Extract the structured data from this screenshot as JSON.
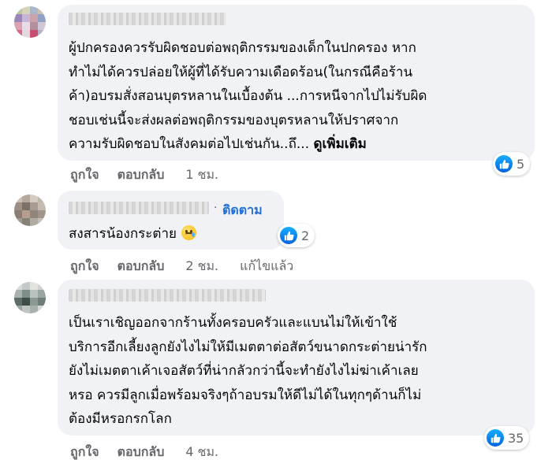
{
  "comments": [
    {
      "text": "ผู้ปกครองควรรับผิดชอบต่อพฤติกรรมของเด็กในปกครอง หาก\nทำไม่ได้ควรปล่อยให้ผู้ที่ได้รับความเดือดร้อน(ในกรณีคือร้าน\nค้า)อบรมสั่งสอนบุตรหลานในเบื้องต้น ...การหนีจากไปไม่รับผิด\nชอบเช่นนี้จะส่งผลต่อพฤติกรรมของบุตรหลานให้ปราศจาก\nความรับผิดชอบในสังคมต่อไปเช่นกัน..ถึ...",
      "see_more": "ดูเพิ่มเติม",
      "like_count": "5",
      "like_label": "ถูกใจ",
      "reply_label": "ตอบกลับ",
      "time": "1 ชม."
    },
    {
      "follow_separator": "·",
      "follow_label": "ติดตาม",
      "text": "สงสารน้องกระต่าย",
      "like_count": "2",
      "like_label": "ถูกใจ",
      "reply_label": "ตอบกลับ",
      "time": "2 ชม.",
      "edited": "แก้ไขแล้ว"
    },
    {
      "text": "เป็นเราเชิญออกจากร้านทั้งครอบครัวและแบนไม่ให้เข้าใช้\nบริการอีกเลี้ยงลูกยังไงไม่ให้มีเมตตาต่อสัตว์ขนาดกระต่ายน่ารัก\nยังไม่เมตตาเค้าเจอสัตว์ที่น่ากลัวกว่านี้จะทำยังไงไม่ฆ่าเค้าเลย\nหรอ ควรมีลูกเมื่อพร้อมจริงๆถ้าอบรมให้ดีไม่ได้ในทุกๆด้านก็ไม่\nต้องมีหรอกรกโลก",
      "like_count": "35",
      "like_label": "ถูกใจ",
      "reply_label": "ตอบกลับ",
      "time": "4 ชม."
    }
  ],
  "colors": {
    "bubble": "#f0f2f5",
    "link_blue": "#216fdb",
    "meta_gray": "#65676b"
  },
  "icons": {
    "reaction": "like-thumb-icon",
    "emoji": "crying-face-emoji"
  }
}
